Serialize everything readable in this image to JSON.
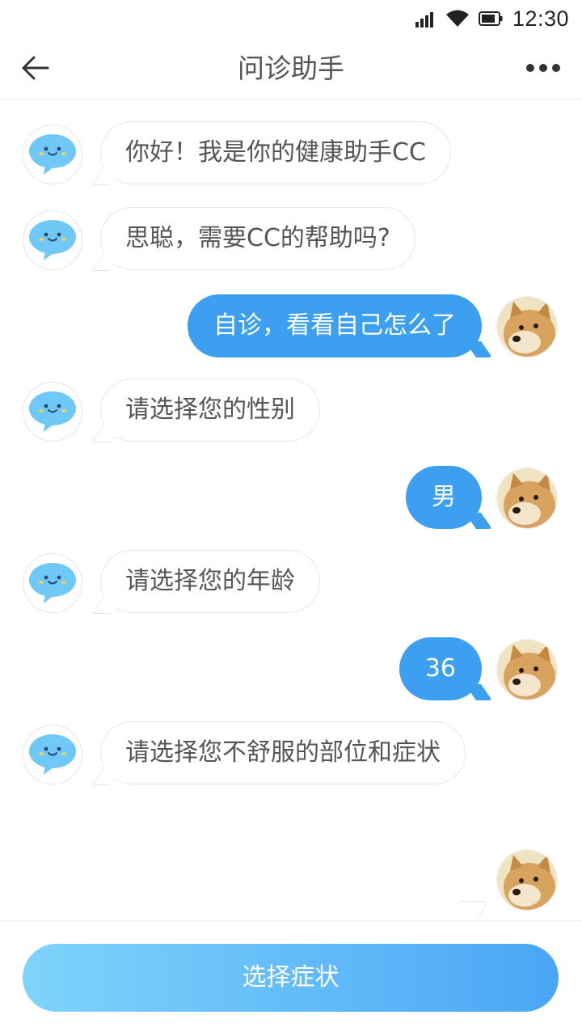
{
  "status_bar": {
    "time": "12:30"
  },
  "nav": {
    "title": "问诊助手",
    "back_icon": "arrow-left-icon",
    "more_icon": "more-dots-icon"
  },
  "messages": [
    {
      "from": "bot",
      "text": "你好！我是你的健康助手CC"
    },
    {
      "from": "bot",
      "text": "思聪，需要CC的帮助吗?"
    },
    {
      "from": "user",
      "text": "自诊，看看自己怎么了"
    },
    {
      "from": "bot",
      "text": "请选择您的性别"
    },
    {
      "from": "user",
      "text": "男"
    },
    {
      "from": "bot",
      "text": "请选择您的年龄"
    },
    {
      "from": "user",
      "text": "36"
    },
    {
      "from": "bot",
      "text": "请选择您不舒服的部位和症状"
    }
  ],
  "bottom": {
    "button_label": "选择症状"
  },
  "colors": {
    "accent": "#3d9ff0",
    "gradient_start": "#7fd3fb",
    "gradient_end": "#4aa6f5"
  }
}
